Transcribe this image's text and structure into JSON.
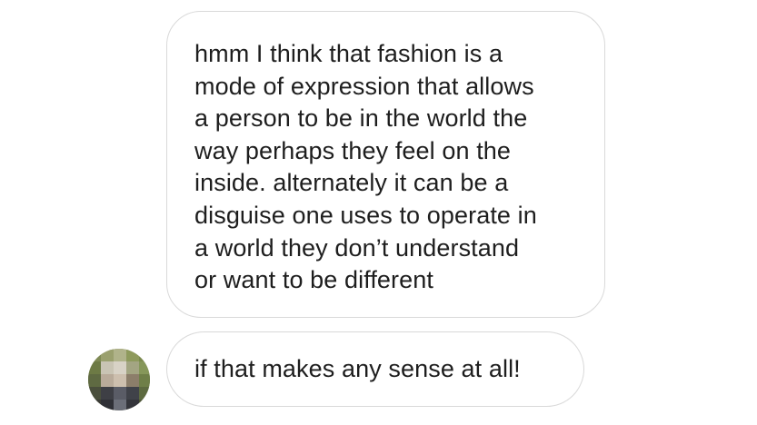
{
  "conversation": {
    "messages": [
      {
        "lines": [
          "hmm I think that fashion is a",
          "mode of expression that allows",
          "a person to be in the world the",
          "way perhaps they feel on the",
          "inside. alternately it can be a",
          "disguise one uses to operate in",
          "a world they don’t understand",
          "or want to be different"
        ]
      },
      {
        "lines": [
          "if that makes any sense at all!"
        ]
      }
    ],
    "avatar": {
      "icon": "pixelated-profile-photo"
    }
  }
}
